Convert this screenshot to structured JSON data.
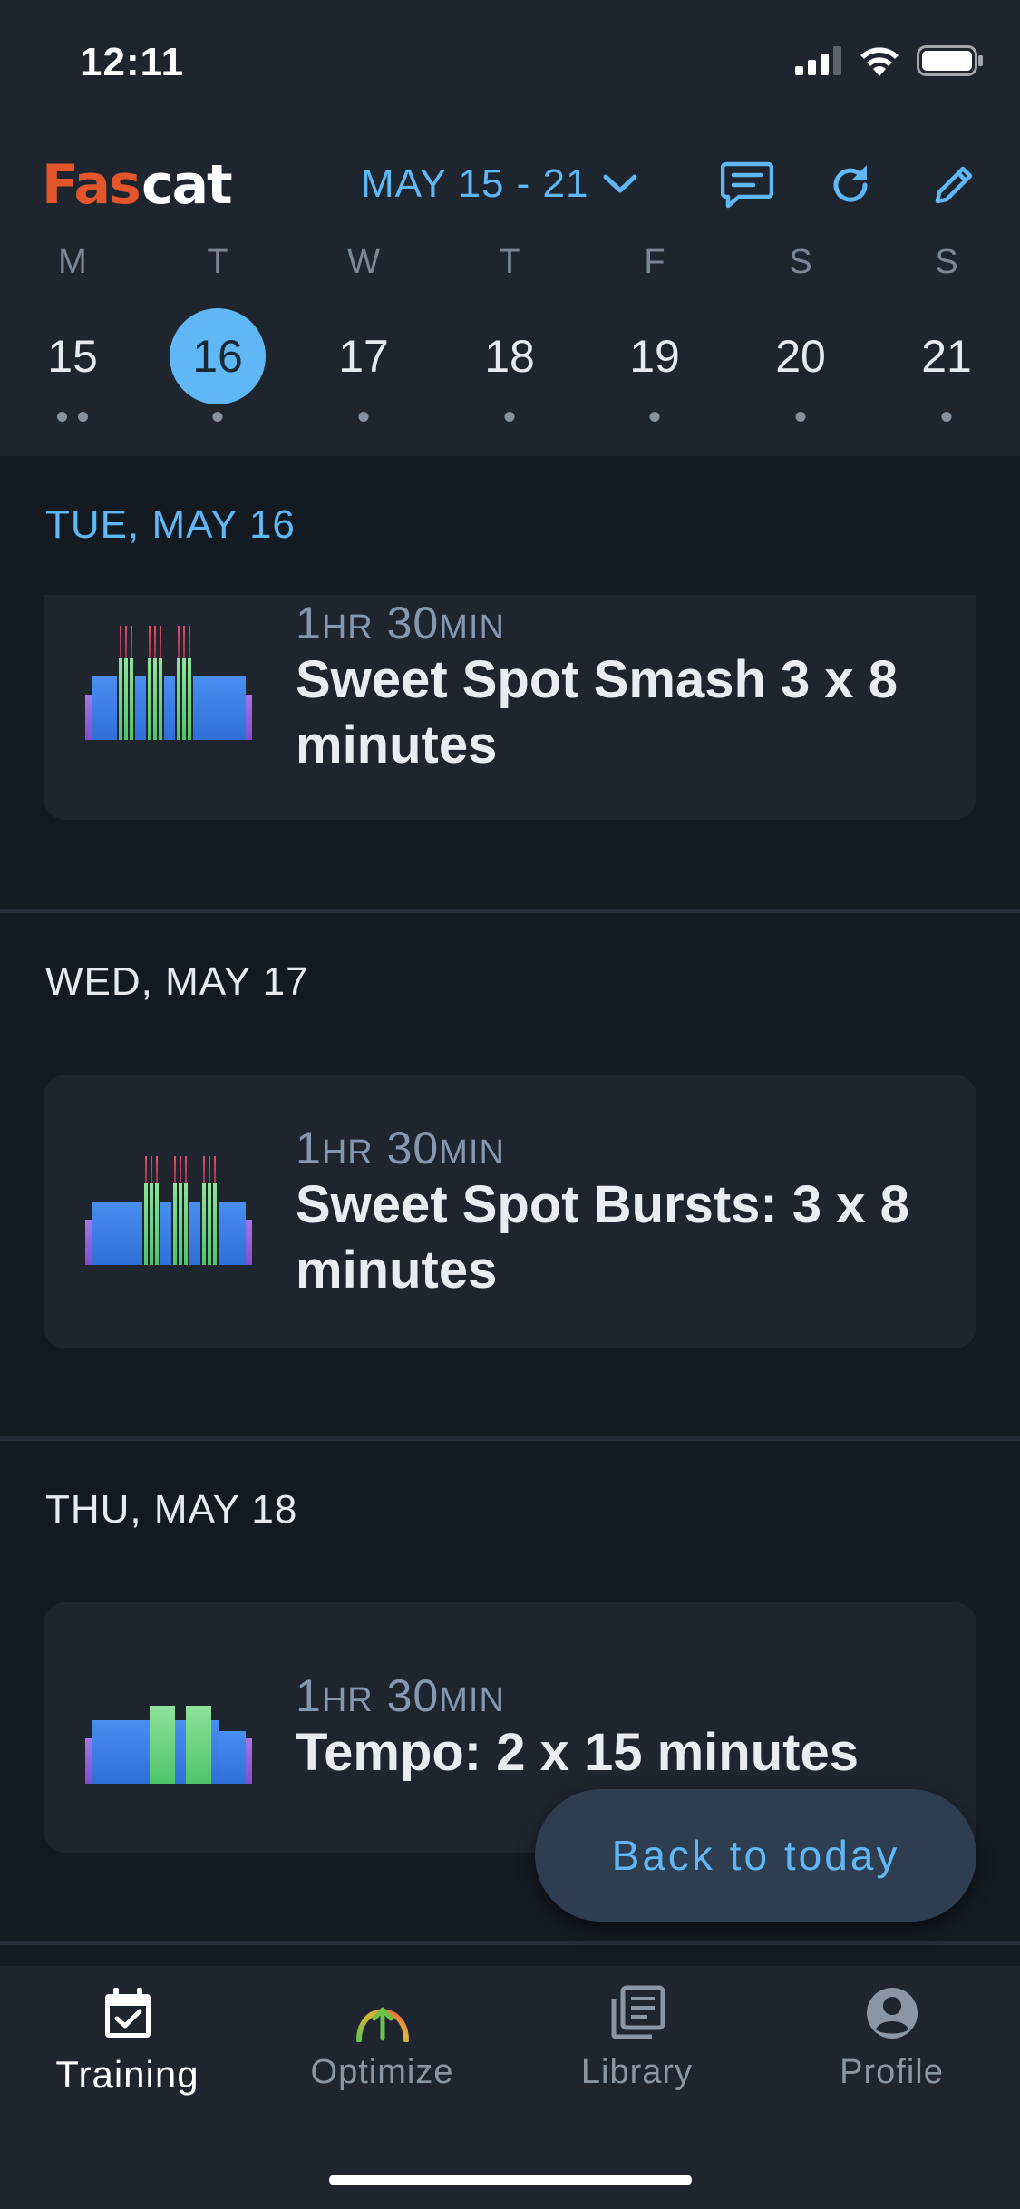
{
  "status_bar": {
    "time": "12:11"
  },
  "header": {
    "logo_text": "FasCat",
    "week_range": "MAY 15 - 21",
    "icons": [
      "chevron-down-icon",
      "chat-icon",
      "refresh-icon",
      "pencil-icon"
    ]
  },
  "week": {
    "days": [
      {
        "dow": "M",
        "num": "15",
        "dots": 2
      },
      {
        "dow": "T",
        "num": "16",
        "dots": 1,
        "selected": true
      },
      {
        "dow": "W",
        "num": "17",
        "dots": 1
      },
      {
        "dow": "T",
        "num": "18",
        "dots": 1
      },
      {
        "dow": "F",
        "num": "19",
        "dots": 1
      },
      {
        "dow": "S",
        "num": "20",
        "dots": 1
      },
      {
        "dow": "S",
        "num": "21",
        "dots": 1
      }
    ]
  },
  "schedule": [
    {
      "date_label": "TUE, MAY 16",
      "workout": {
        "hours": "1",
        "hr_unit": "HR",
        "minutes": "30",
        "min_unit": "MIN",
        "name": "Sweet Spot Smash 3 x 8 minutes"
      }
    },
    {
      "date_label": "WED, MAY 17",
      "workout": {
        "hours": "1",
        "hr_unit": "HR",
        "minutes": "30",
        "min_unit": "MIN",
        "name": "Sweet Spot Bursts: 3 x 8 minutes"
      }
    },
    {
      "date_label": "THU, MAY 18",
      "workout": {
        "hours": "1",
        "hr_unit": "HR",
        "minutes": "30",
        "min_unit": "MIN",
        "name": "Tempo: 2 x 15 minutes"
      }
    }
  ],
  "back_to_today": "Back to today",
  "tabs": [
    {
      "label": "Training",
      "icon": "calendar-check-icon",
      "active": true
    },
    {
      "label": "Optimize",
      "icon": "optimize-arrow-icon"
    },
    {
      "label": "Library",
      "icon": "library-icon"
    },
    {
      "label": "Profile",
      "icon": "profile-icon"
    }
  ],
  "colors": {
    "accent": "#5fb8f5",
    "background": "#141a22",
    "surface": "#1e252f"
  }
}
